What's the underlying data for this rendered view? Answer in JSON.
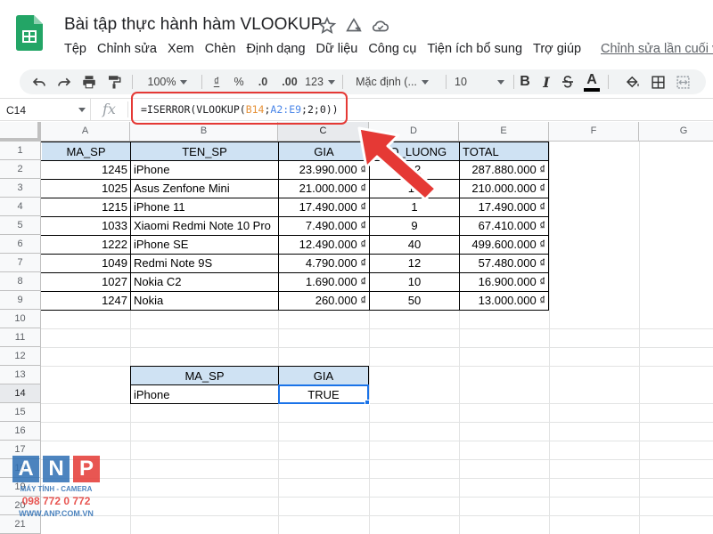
{
  "doc": {
    "title": "Bài tập thực hành hàm VLOOKUP",
    "last_edit": "Chỉnh sửa lần cuối vào"
  },
  "menu": [
    "Tệp",
    "Chỉnh sửa",
    "Xem",
    "Chèn",
    "Định dạng",
    "Dữ liệu",
    "Công cụ",
    "Tiện ích bổ sung",
    "Trợ giúp"
  ],
  "toolbar": {
    "zoom": "100%",
    "currency": "₫",
    "percent": "%",
    "decimal_decrease": ".0",
    "decimal_increase": ".00",
    "more_formats": "123",
    "font": "Mặc định (...",
    "font_size": "10",
    "bold": "B",
    "italic": "I",
    "text_color": "A"
  },
  "formula_bar": {
    "cell_ref": "C14",
    "fx": "fx",
    "formula_prefix": "=ISERROR(VLOOKUP(",
    "formula_ref1": "B14",
    "formula_sep": ";",
    "formula_ref2": "A2:E9",
    "formula_suffix": ";2;0))"
  },
  "columns": [
    "A",
    "B",
    "C",
    "D",
    "E",
    "F",
    "G"
  ],
  "active_column": "C",
  "rows": [
    "1",
    "2",
    "3",
    "4",
    "5",
    "6",
    "7",
    "8",
    "9",
    "10",
    "11",
    "12",
    "13",
    "14",
    "15",
    "16",
    "17",
    "18",
    "19",
    "20",
    "21"
  ],
  "active_row": "14",
  "table": {
    "headers": [
      "MA_SP",
      "TEN_SP",
      "GIA",
      "SO_LUONG",
      "TOTAL"
    ],
    "rows": [
      [
        "1245",
        "iPhone",
        "23.990.000 ₫",
        "12",
        "287.880.000 ₫"
      ],
      [
        "1025",
        "Asus Zenfone Mini",
        "21.000.000 ₫",
        "10",
        "210.000.000 ₫"
      ],
      [
        "1215",
        "iPhone 11",
        "17.490.000 ₫",
        "1",
        "17.490.000 ₫"
      ],
      [
        "1033",
        "Xiaomi Redmi Note 10 Pro",
        "7.490.000 ₫",
        "9",
        "67.410.000 ₫"
      ],
      [
        "1222",
        "iPhone SE",
        "12.490.000 ₫",
        "40",
        "499.600.000 ₫"
      ],
      [
        "1049",
        "Redmi Note 9S",
        "4.790.000 ₫",
        "12",
        "57.480.000 ₫"
      ],
      [
        "1027",
        "Nokia C2",
        "1.690.000 ₫",
        "10",
        "16.900.000 ₫"
      ],
      [
        "1247",
        "Nokia",
        "260.000 ₫",
        "50",
        "13.000.000 ₫"
      ]
    ]
  },
  "lookup": {
    "headers": [
      "MA_SP",
      "GIA"
    ],
    "values": [
      "iPhone",
      "TRUE"
    ]
  },
  "watermark": {
    "letters": [
      "A",
      "N",
      "P"
    ],
    "tagline": "MÁY TÍNH - CAMERA",
    "phone": "098 772 0 772",
    "site": "WWW.ANP.COM.VN"
  },
  "colors": {
    "header_fill": "#cfe2f3",
    "highlight": "#e53935",
    "selection": "#1a73e8"
  }
}
